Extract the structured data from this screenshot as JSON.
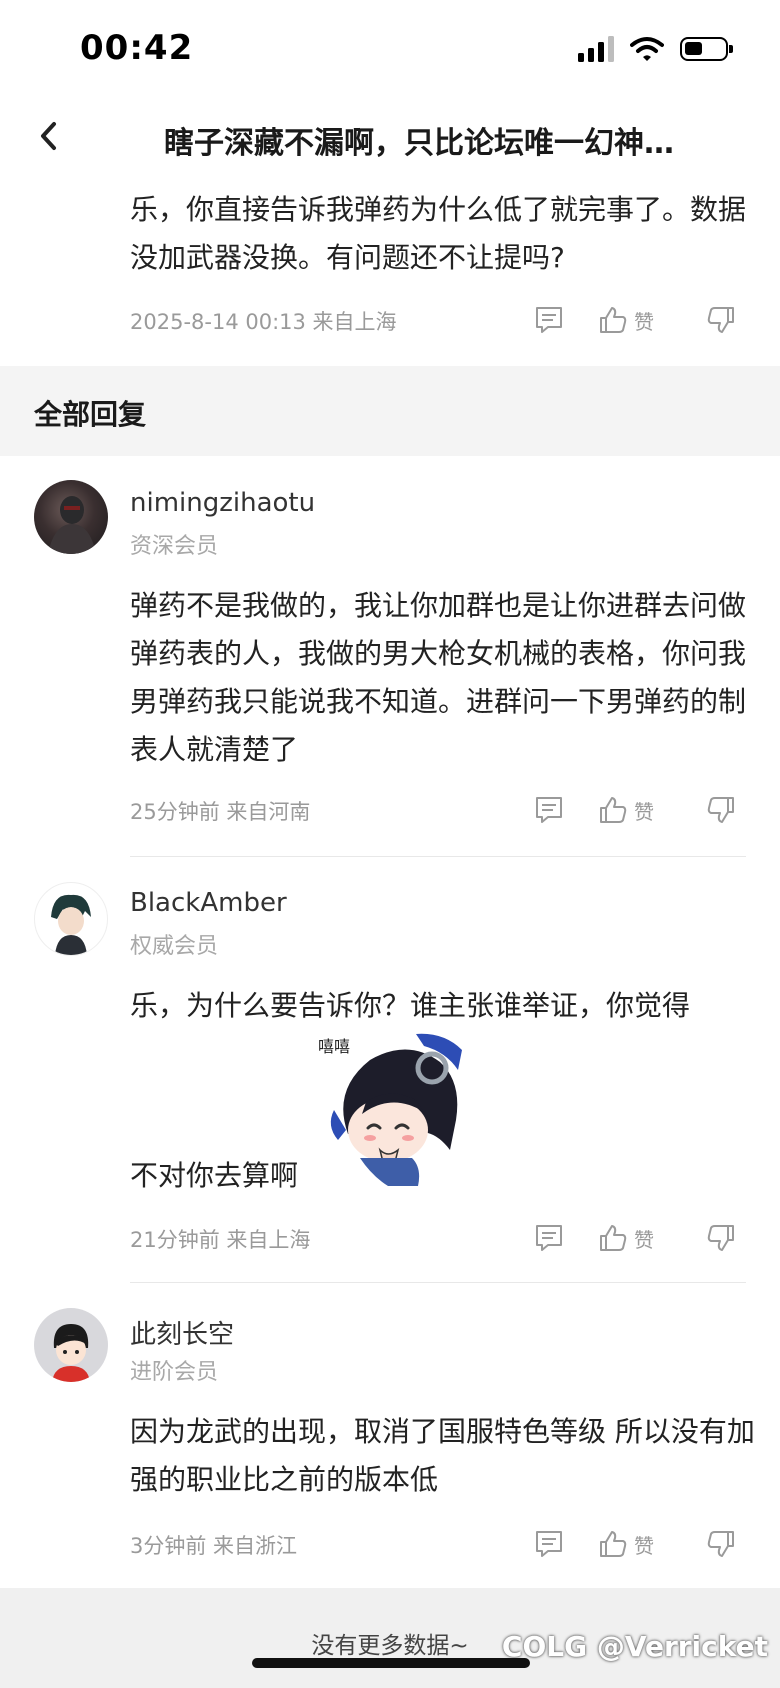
{
  "status_bar": {
    "time": "00:42"
  },
  "nav": {
    "title": "瞎子深藏不漏啊，只比论坛唯一幻神…"
  },
  "post": {
    "text": "乐，你直接告诉我弹药为什么低了就完事了。数据没加武器没换。有问题还不让提吗?",
    "meta": "2025-8-14 00:13  来自上海",
    "like_label": "赞"
  },
  "section": {
    "title": "全部回复"
  },
  "replies": [
    {
      "username": "nimingzihaotu",
      "rank": "资深会员",
      "text": "弹药不是我做的，我让你加群也是让你进群去问做弹药表的人，我做的男大枪女机械的表格，你问我男弹药我只能说我不知道。进群问一下男弹药的制表人就清楚了",
      "meta": "25分钟前 来自河南",
      "like_label": "赞"
    },
    {
      "username": "BlackAmber",
      "rank": "权威会员",
      "text_line1": "乐，为什么要告诉你？谁主张谁举证，你觉得",
      "text_line2": "不对你去算啊",
      "sticker_text": "嘻嘻",
      "meta": "21分钟前 来自上海",
      "like_label": "赞"
    },
    {
      "username": "此刻长空",
      "rank": "进阶会员",
      "text": "因为龙武的出现，取消了国服特色等级  所以没有加强的职业比之前的版本低",
      "meta": "3分钟前 来自浙江",
      "like_label": "赞"
    }
  ],
  "footer": {
    "text": "没有更多数据~"
  },
  "watermark": "COLG @Verricket",
  "icons": {
    "back": "chevron-left-icon",
    "comment": "comment-icon",
    "like": "thumbs-up-icon",
    "dislike": "thumbs-down-icon",
    "signal": "signal-icon",
    "wifi": "wifi-icon",
    "battery": "battery-icon"
  },
  "battery_level": 0.45
}
